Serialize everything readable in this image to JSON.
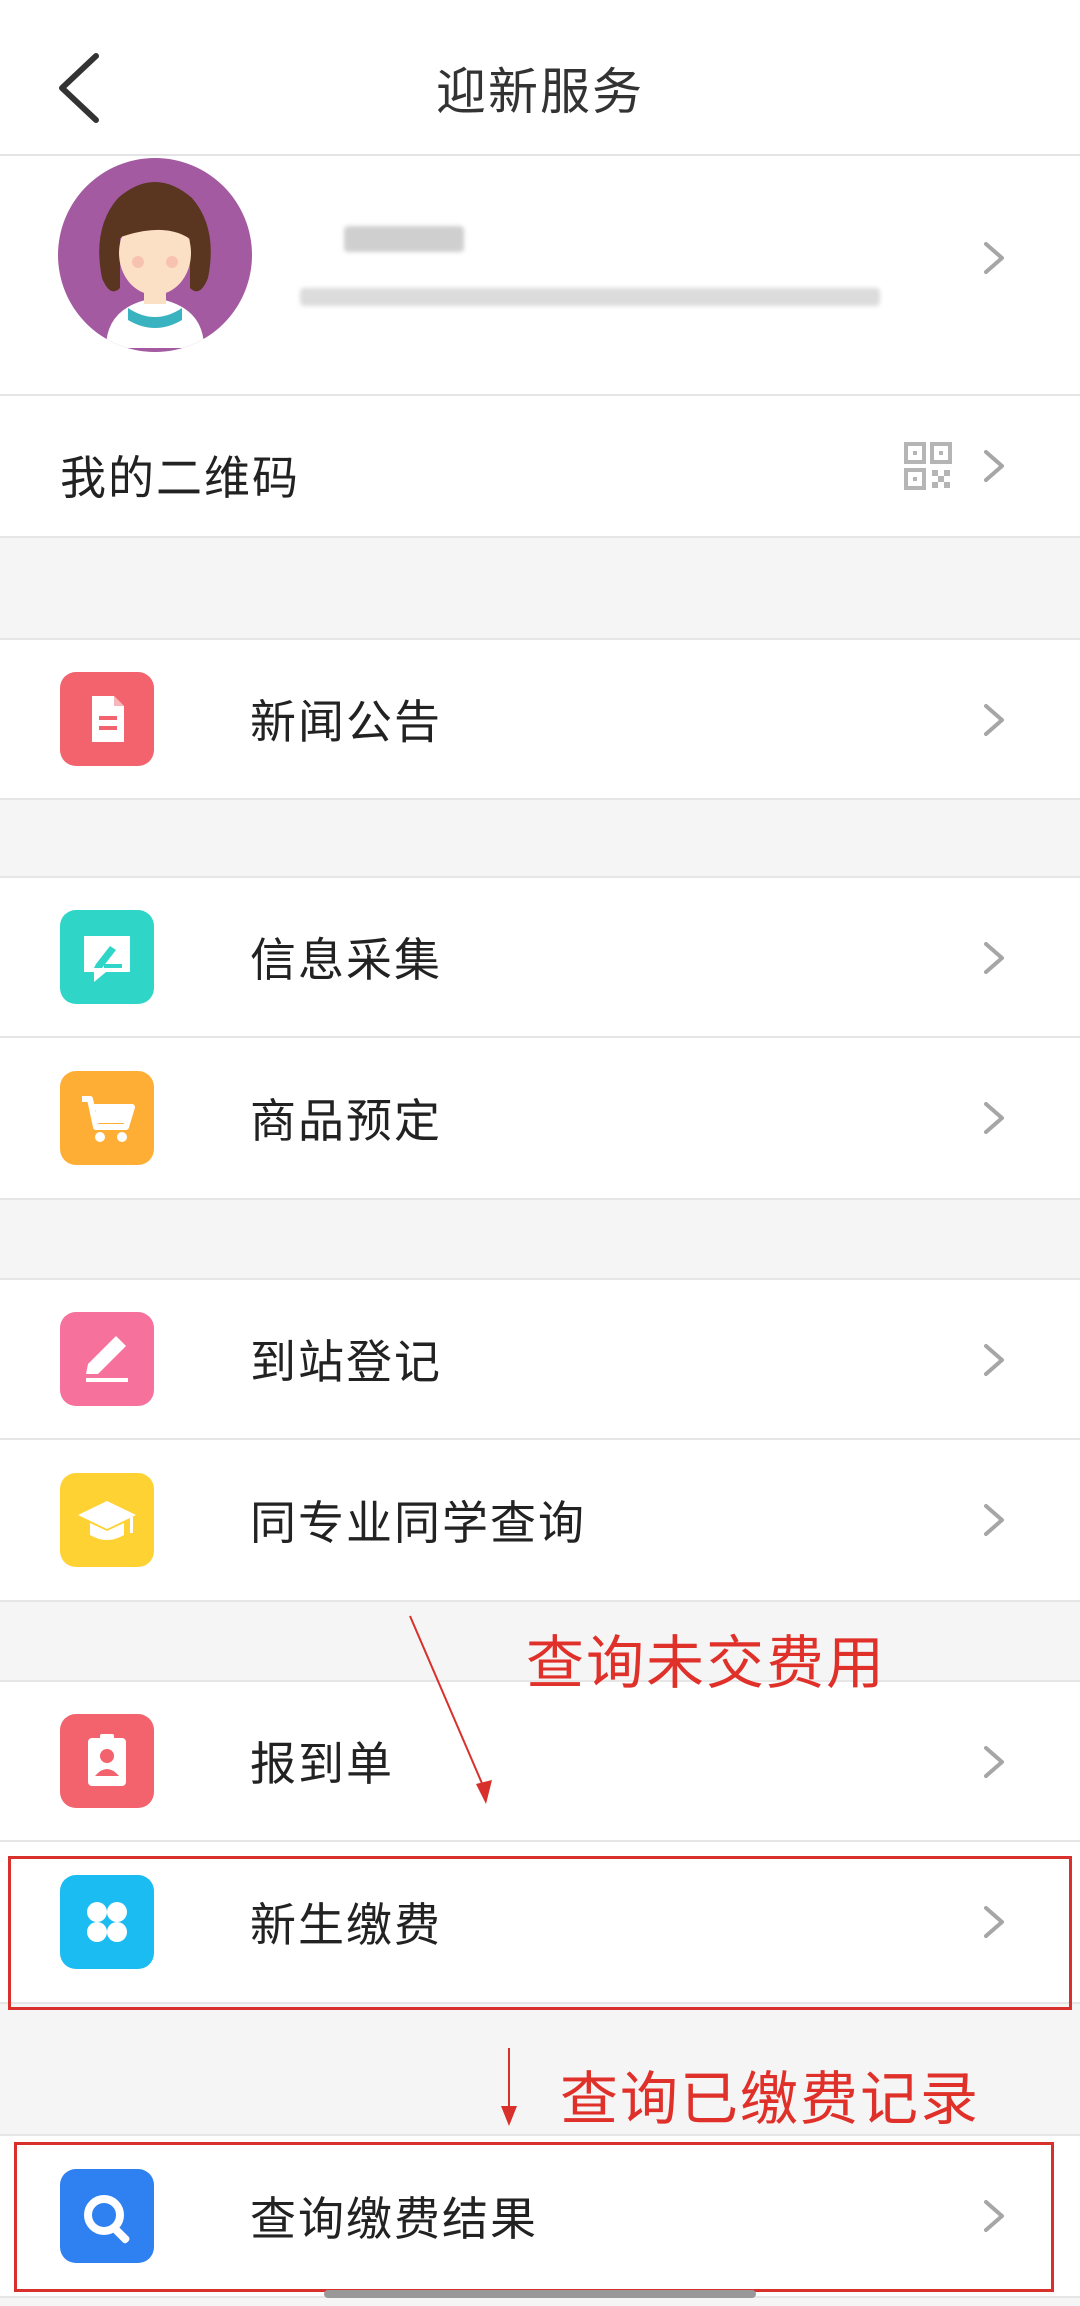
{
  "nav": {
    "title": "迎新服务",
    "back_icon": "back-arrow-icon"
  },
  "profile": {
    "avatar_icon": "girl-avatar-icon"
  },
  "qrcode_row": {
    "label": "我的二维码",
    "icon": "qr-code-icon"
  },
  "menu": {
    "news": {
      "label": "新闻公告",
      "icon": "document-icon",
      "color": "#f2636d"
    },
    "info": {
      "label": "信息采集",
      "icon": "edit-box-icon",
      "color": "#2fd6c8"
    },
    "goods": {
      "label": "商品预定",
      "icon": "cart-icon",
      "color": "#ffae35"
    },
    "arrive": {
      "label": "到站登记",
      "icon": "pencil-icon",
      "color": "#f6719b"
    },
    "classmates": {
      "label": "同专业同学查询",
      "icon": "graduation-cap-icon",
      "color": "#ffd234"
    },
    "report": {
      "label": "报到单",
      "icon": "id-badge-icon",
      "color": "#f2636d"
    },
    "payment": {
      "label": "新生缴费",
      "icon": "clover-icon",
      "color": "#1bbcf2"
    },
    "payment_result": {
      "label": "查询缴费结果",
      "icon": "search-icon",
      "color": "#2f80f0"
    }
  },
  "annotations": {
    "unpaid": "查询未交费用",
    "paid": "查询已缴费记录",
    "color": "#e0302a"
  }
}
